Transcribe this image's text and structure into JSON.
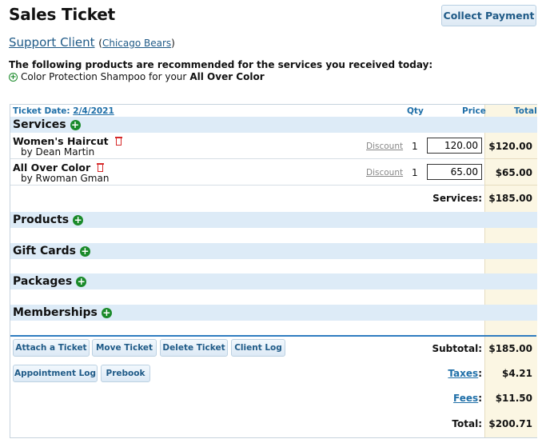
{
  "header": {
    "title": "Sales Ticket",
    "collect_payment": "Collect Payment"
  },
  "client": {
    "name": "Support Client",
    "team_open": "(",
    "team": "Chicago Bears",
    "team_close": ")"
  },
  "recommendation": {
    "heading": "The following products are recommended for the services you received today:",
    "item_prefix": "Color Protection Shampoo for your",
    "item_service": "All Over Color"
  },
  "ticket": {
    "date_label": "Ticket Date:",
    "date_value": "2/4/2021",
    "col_qty": "Qty",
    "col_price": "Price",
    "col_total": "Total"
  },
  "sections": {
    "services": "Services",
    "products": "Products",
    "gift_cards": "Gift Cards",
    "packages": "Packages",
    "memberships": "Memberships"
  },
  "services": [
    {
      "name": "Women's Haircut",
      "by": "by Dean Martin",
      "discount": "Discount",
      "qty": "1",
      "price": "120.00",
      "total": "$120.00"
    },
    {
      "name": "All Over Color",
      "by": "by Rwoman Gman",
      "discount": "Discount",
      "qty": "1",
      "price": "65.00",
      "total": "$65.00"
    }
  ],
  "services_summary": {
    "label": "Services:",
    "value": "$185.00"
  },
  "actions": {
    "attach": "Attach a Ticket",
    "move": "Move Ticket",
    "delete": "Delete Ticket",
    "client_log": "Client Log",
    "appointment_log": "Appointment Log",
    "prebook": "Prebook"
  },
  "summary": {
    "subtotal_label": "Subtotal:",
    "subtotal_value": "$185.00",
    "taxes_label": "Taxes",
    "taxes_value": "$4.21",
    "fees_label": "Fees",
    "fees_value": "$11.50",
    "total_label": "Total:",
    "total_value": "$200.71"
  },
  "icons": {
    "add": "plus-circle-icon",
    "delete": "trash-icon"
  },
  "colors": {
    "section_bg": "#ddebf7",
    "total_column_bg": "#fbf6e3",
    "link": "#1f5a87",
    "add_green": "#1a8a2a",
    "delete_red": "#d62a2a"
  }
}
